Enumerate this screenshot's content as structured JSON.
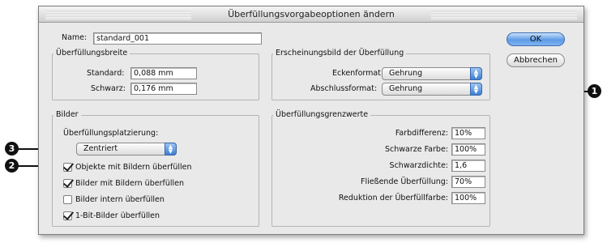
{
  "window": {
    "title": "Überfüllungsvorgabeoptionen ändern"
  },
  "name": {
    "label": "Name:",
    "value": "standard_001"
  },
  "breite": {
    "title": "Überfüllungsbreite",
    "standard_label": "Standard:",
    "standard_value": "0,088 mm",
    "schwarz_label": "Schwarz:",
    "schwarz_value": "0,176 mm"
  },
  "erscheinung": {
    "title": "Erscheinungsbild der Überfüllung",
    "ecken_label": "Eckenformat:",
    "ecken_value": "Gehrung",
    "abschluss_label": "Abschlussformat:",
    "abschluss_value": "Gehrung"
  },
  "bilder": {
    "title": "Bilder",
    "platz_label": "Überfüllungsplatzierung:",
    "platz_value": "Zentriert",
    "checkboxes": [
      {
        "label": "Objekte mit Bildern überfüllen",
        "checked": true
      },
      {
        "label": "Bilder mit Bildern überfüllen",
        "checked": true
      },
      {
        "label": "Bilder intern überfüllen",
        "checked": false
      },
      {
        "label": "1-Bit-Bilder überfüllen",
        "checked": true
      }
    ]
  },
  "grenzwerte": {
    "title": "Überfüllungsgrenzwerte",
    "rows": [
      {
        "label": "Farbdifferenz:",
        "value": "10%"
      },
      {
        "label": "Schwarze Farbe:",
        "value": "100%"
      },
      {
        "label": "Schwarzdichte:",
        "value": "1,6"
      },
      {
        "label": "Fließende Überfüllung:",
        "value": "70%"
      },
      {
        "label": "Reduktion der Überfüllfarbe:",
        "value": "100%"
      }
    ]
  },
  "buttons": {
    "ok": "OK",
    "cancel": "Abbrechen"
  },
  "callouts": {
    "c1": "1",
    "c2": "2",
    "c3": "3"
  },
  "colors": {
    "accent": "#5d9be6",
    "callout": "#111111"
  }
}
